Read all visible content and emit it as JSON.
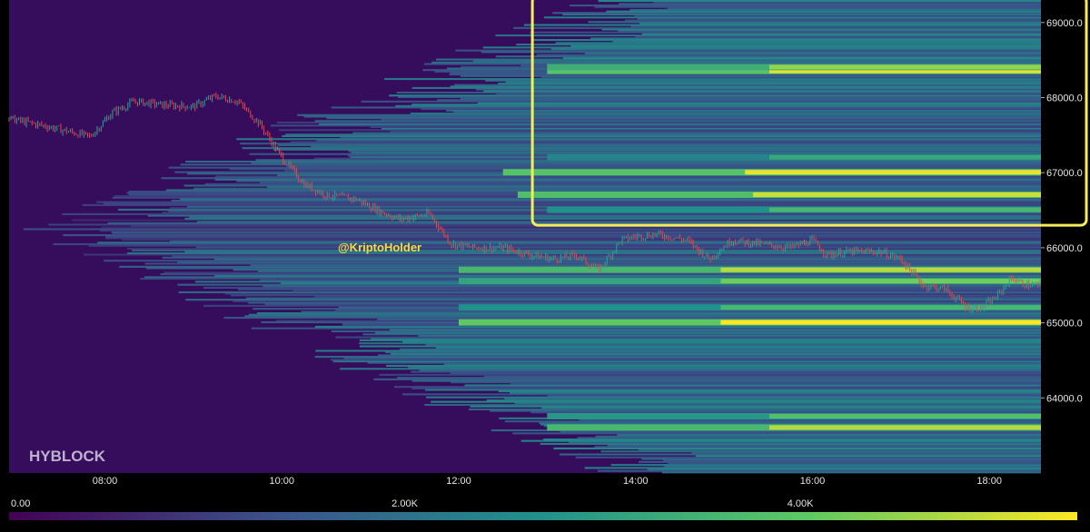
{
  "watermark": "HYBLOCK",
  "annotation": "@KriptoHolder",
  "colors": {
    "background": "#350d5c",
    "highlight_box": "#f5ec5a",
    "annotation_text": "#f5dc3c",
    "candle_up": "#26a69a",
    "candle_down": "#ef4444",
    "colorscale": [
      "#440154",
      "#3b528b",
      "#21918c",
      "#5ec962",
      "#fde725"
    ]
  },
  "chart_data": {
    "type": "heatmap",
    "title": "",
    "xlabel": "",
    "ylabel": "",
    "x_ticks": [
      "08:00",
      "10:00",
      "12:00",
      "14:00",
      "16:00",
      "18:00"
    ],
    "y_ticks": [
      "64000.0",
      "65000.0",
      "66000.0",
      "67000.0",
      "68000.0",
      "69000.0"
    ],
    "xlim": [
      "06:55",
      "18:35"
    ],
    "ylim": [
      63000,
      69300
    ],
    "colorbar": {
      "ticks": [
        "0.00",
        "2.00K",
        "4.00K"
      ],
      "range": [
        0,
        5400
      ]
    },
    "liquidation_bands": [
      {
        "price": 65000,
        "value": 5400,
        "start": "12:00"
      },
      {
        "price": 66700,
        "value": 5000,
        "start": "12:40"
      },
      {
        "price": 67000,
        "value": 5200,
        "start": "12:30"
      },
      {
        "price": 68350,
        "value": 5200,
        "start": "13:00"
      },
      {
        "price": 68400,
        "value": 4500,
        "start": "13:00"
      },
      {
        "price": 65700,
        "value": 4800,
        "start": "12:00"
      },
      {
        "price": 65550,
        "value": 4200,
        "start": "12:00"
      },
      {
        "price": 63600,
        "value": 4800,
        "start": "13:00"
      },
      {
        "price": 63750,
        "value": 3800,
        "start": "13:00"
      },
      {
        "price": 65200,
        "value": 3600,
        "start": "12:00"
      },
      {
        "price": 66500,
        "value": 3600,
        "start": "13:00"
      },
      {
        "price": 67200,
        "value": 3200,
        "start": "13:00"
      }
    ],
    "price_path": [
      [
        "06:55",
        67720
      ],
      [
        "07:20",
        67620
      ],
      [
        "07:50",
        67480
      ],
      [
        "08:05",
        67800
      ],
      [
        "08:20",
        67950
      ],
      [
        "08:40",
        67900
      ],
      [
        "09:00",
        67880
      ],
      [
        "09:15",
        68020
      ],
      [
        "09:30",
        67950
      ],
      [
        "09:45",
        67650
      ],
      [
        "10:00",
        67200
      ],
      [
        "10:15",
        66850
      ],
      [
        "10:30",
        66700
      ],
      [
        "10:50",
        66650
      ],
      [
        "11:05",
        66500
      ],
      [
        "11:20",
        66380
      ],
      [
        "11:40",
        66450
      ],
      [
        "11:55",
        66050
      ],
      [
        "12:10",
        66000
      ],
      [
        "12:30",
        66000
      ],
      [
        "12:50",
        65900
      ],
      [
        "13:05",
        65850
      ],
      [
        "13:20",
        65900
      ],
      [
        "13:35",
        65700
      ],
      [
        "13:50",
        66100
      ],
      [
        "14:00",
        66150
      ],
      [
        "14:15",
        66180
      ],
      [
        "14:35",
        66100
      ],
      [
        "14:50",
        65850
      ],
      [
        "15:05",
        66100
      ],
      [
        "15:25",
        66050
      ],
      [
        "15:45",
        66000
      ],
      [
        "16:00",
        66100
      ],
      [
        "16:10",
        65900
      ],
      [
        "16:25",
        65950
      ],
      [
        "16:45",
        65950
      ],
      [
        "17:00",
        65850
      ],
      [
        "17:15",
        65500
      ],
      [
        "17:30",
        65450
      ],
      [
        "17:45",
        65200
      ],
      [
        "17:55",
        65200
      ],
      [
        "18:05",
        65350
      ],
      [
        "18:15",
        65600
      ],
      [
        "18:25",
        65500
      ],
      [
        "18:35",
        65500
      ]
    ],
    "highlight_box": {
      "x_start": "12:50",
      "x_end": "18:35",
      "y_min": 66300,
      "y_max": 69350
    }
  }
}
